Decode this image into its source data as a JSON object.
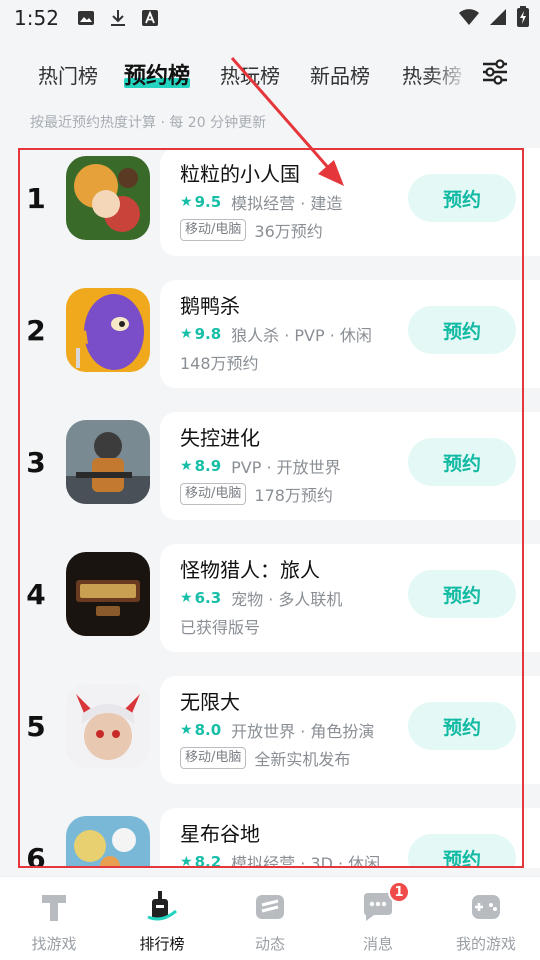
{
  "status_bar": {
    "time": "1:52"
  },
  "tabs": [
    {
      "label": "热门榜"
    },
    {
      "label": "预约榜"
    },
    {
      "label": "热玩榜"
    },
    {
      "label": "新品榜"
    },
    {
      "label": "热卖榜"
    }
  ],
  "subtitle": "按最近预约热度计算 · 每 20 分钟更新",
  "games": [
    {
      "rank": "1",
      "title": "粒粒的小人国",
      "rating": "9.5",
      "tags": "模拟经营 · 建造",
      "platform": "移动/电脑",
      "info": "36万预约",
      "button": "预约",
      "icon_colors": [
        "#3a6a2a",
        "#e6a13a",
        "#c8433a"
      ]
    },
    {
      "rank": "2",
      "title": "鹅鸭杀",
      "rating": "9.8",
      "tags": "狼人杀 · PVP · 休闲",
      "platform": "",
      "info": "148万预约",
      "button": "预约",
      "icon_colors": [
        "#f0a81c",
        "#7a4ec8",
        "#f6e9c8"
      ]
    },
    {
      "rank": "3",
      "title": "失控进化",
      "rating": "8.9",
      "tags": "PVP · 开放世界",
      "platform": "移动/电脑",
      "info": "178万预约",
      "button": "预约",
      "icon_colors": [
        "#7a8a92",
        "#c47a2e",
        "#3c3c3c"
      ]
    },
    {
      "rank": "4",
      "title": "怪物猎人：旅人",
      "rating": "6.3",
      "tags": "宠物 · 多人联机",
      "platform": "",
      "info": "已获得版号",
      "button": "预约",
      "icon_colors": [
        "#1a1410",
        "#c9a052",
        "#6a3a20"
      ]
    },
    {
      "rank": "5",
      "title": "无限大",
      "rating": "8.0",
      "tags": "开放世界 · 角色扮演",
      "platform": "移动/电脑",
      "info": "全新实机发布",
      "button": "预约",
      "icon_colors": [
        "#f2f2f4",
        "#d8363a",
        "#e8c8b0"
      ]
    },
    {
      "rank": "6",
      "title": "星布谷地",
      "rating": "8.2",
      "tags": "模拟经营 · 3D · 休闲",
      "platform": "",
      "info": "",
      "button": "预约",
      "icon_colors": [
        "#e8d070",
        "#7ab8d8",
        "#5a9a4a"
      ]
    }
  ],
  "bottom_nav": [
    {
      "label": "找游戏",
      "icon": "find-game-icon"
    },
    {
      "label": "排行榜",
      "icon": "ranking-icon"
    },
    {
      "label": "动态",
      "icon": "feed-icon"
    },
    {
      "label": "消息",
      "icon": "message-icon",
      "badge": "1"
    },
    {
      "label": "我的游戏",
      "icon": "my-games-icon"
    }
  ],
  "colors": {
    "accent": "#17bfa8",
    "button_bg": "#e4f8f5",
    "annotation_red": "#e5363b",
    "tab_highlight": "#23d4c0"
  }
}
